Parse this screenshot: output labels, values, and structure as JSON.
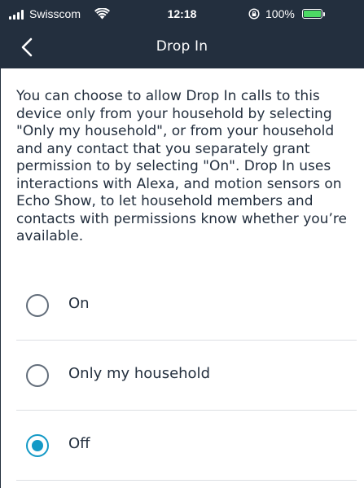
{
  "status_bar": {
    "carrier": "Swisscom",
    "time": "12:18",
    "battery_percent": "100%",
    "battery_level": 1.0,
    "battery_color": "#4cd964",
    "icons": [
      "signal-bars-icon",
      "wifi-icon",
      "rotation-lock-icon",
      "battery-icon"
    ]
  },
  "nav": {
    "title": "Drop In",
    "back_icon": "chevron-left-icon"
  },
  "description": "You can choose to allow Drop In calls to this device only from your household by selecting \"Only my household\", or from your household and any contact that you separately grant permission to by selecting \"On\". Drop In uses interactions with Alexa, and motion sensors on Echo Show, to let household members and contacts with permissions know whether you’re available.",
  "options": [
    {
      "label": "On",
      "selected": false
    },
    {
      "label": "Only my household",
      "selected": false
    },
    {
      "label": "Off",
      "selected": true
    }
  ],
  "colors": {
    "header_bg": "#232f3e",
    "accent": "#1399c6",
    "text": "#232f3e",
    "divider": "#dcdfe3"
  }
}
